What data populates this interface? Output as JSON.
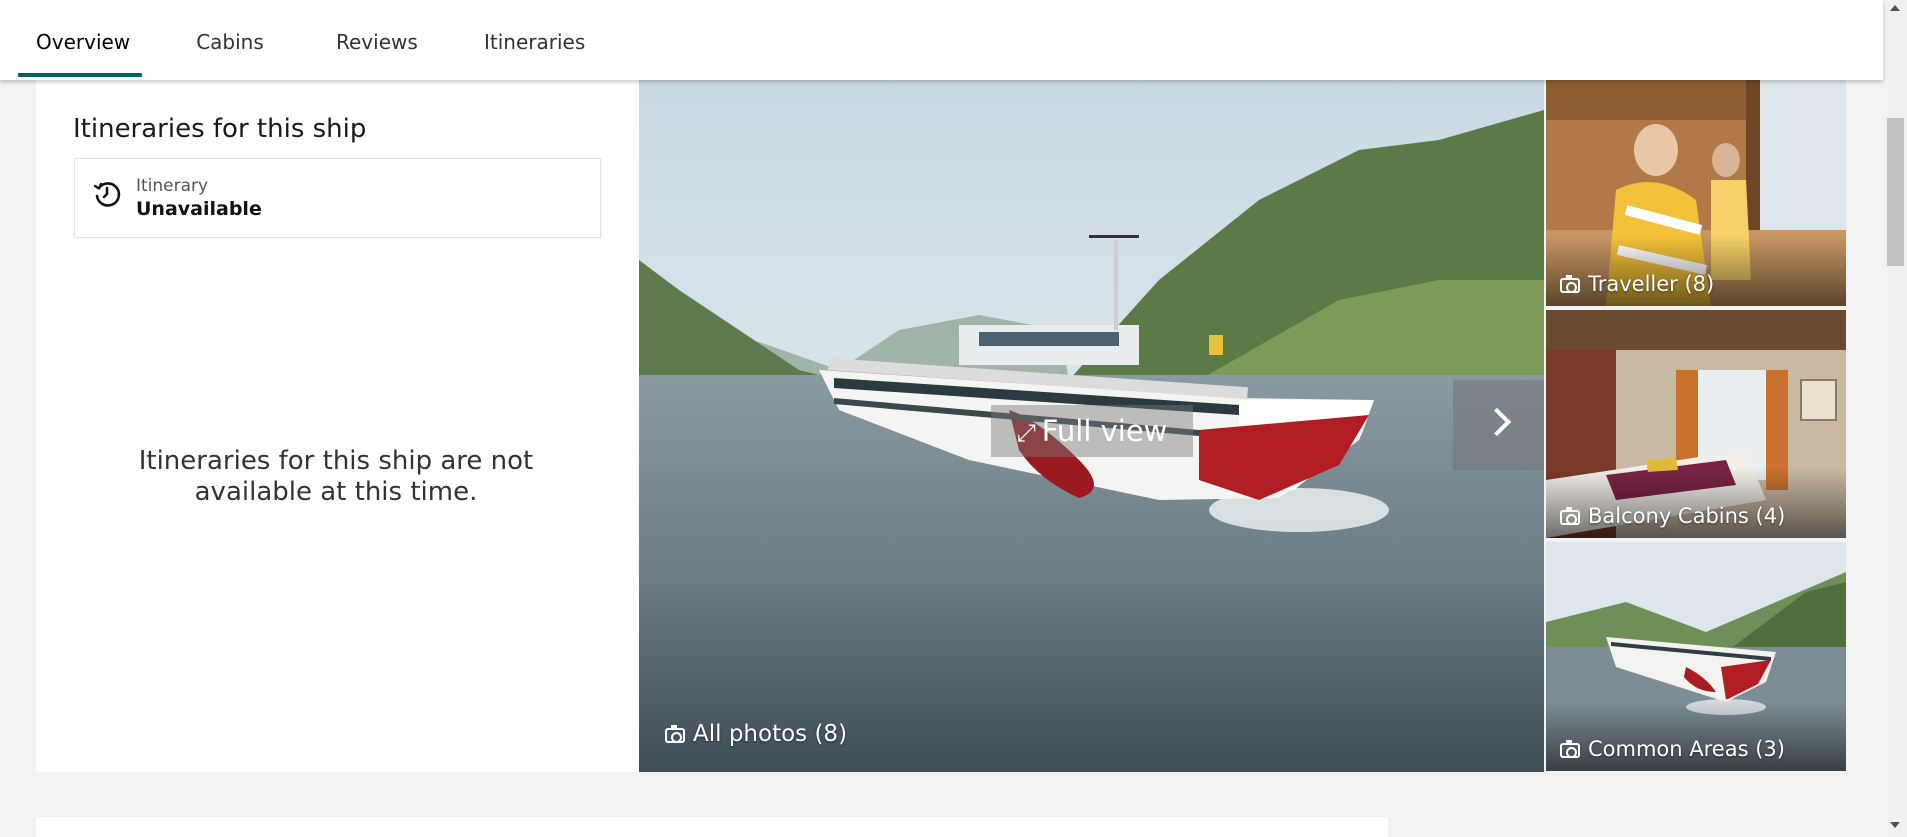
{
  "tabs": [
    {
      "label": "Overview",
      "active": true
    },
    {
      "label": "Cabins",
      "active": false
    },
    {
      "label": "Reviews",
      "active": false
    },
    {
      "label": "Itineraries",
      "active": false
    }
  ],
  "accent_color": "#00645a",
  "itineraries_panel": {
    "title": "Itineraries for this ship",
    "status_label": "Itinerary",
    "status_value": "Unavailable",
    "status_icon": "clock-history-icon",
    "message": "Itineraries for this ship are not available at this time."
  },
  "gallery": {
    "full_view_label": "Full view",
    "all_photos_label": "All photos (8)",
    "thumbnails": [
      {
        "label": "Traveller (8)",
        "icon": "camera-icon"
      },
      {
        "label": "Balcony Cabins (4)",
        "icon": "camera-icon"
      },
      {
        "label": "Common Areas (3)",
        "icon": "camera-icon"
      }
    ]
  }
}
